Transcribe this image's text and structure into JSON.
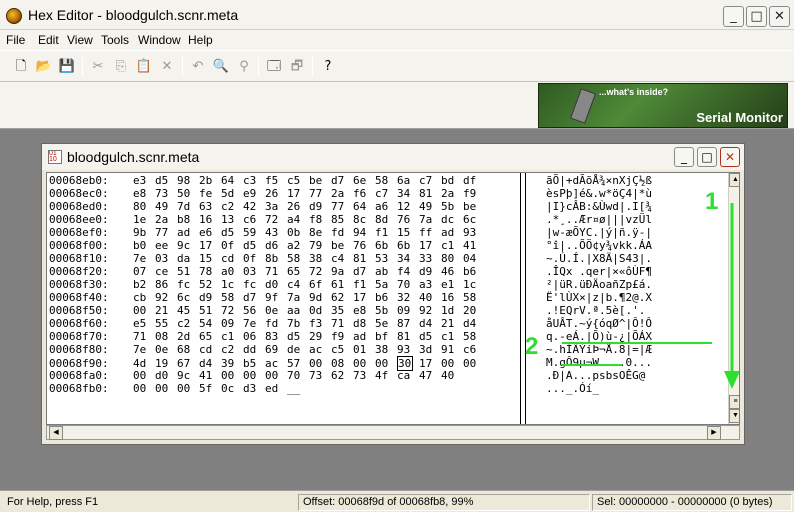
{
  "window": {
    "title": "Hex Editor - bloodgulch.scnr.meta",
    "min_icon": "minimize-icon",
    "max_icon": "maximize-icon",
    "close_icon": "close-icon"
  },
  "menu": [
    "File",
    "Edit",
    "View",
    "Tools",
    "Window",
    "Help"
  ],
  "toolbar_icons": [
    "new-icon",
    "open-icon",
    "save-icon",
    "cut-icon",
    "copy-icon",
    "paste-icon",
    "delete-icon",
    "undo-icon",
    "find-icon",
    "replace-icon",
    "export-icon",
    "import-icon",
    "help-icon"
  ],
  "banner": {
    "tagline": "...what's inside?",
    "name": "Serial Monitor"
  },
  "document": {
    "title": "bloodgulch.scnr.meta",
    "rows": [
      {
        "offset": "00068eb0:",
        "bytes": [
          "e3",
          "d5",
          "98",
          "2b",
          "64",
          "c3",
          "f5",
          "c5",
          "be",
          "d7",
          "6e",
          "58",
          "6a",
          "c7",
          "bd",
          "df"
        ],
        "ascii": "ãÕ|+dÃõÅ¾×nXjÇ½ß"
      },
      {
        "offset": "00068ec0:",
        "bytes": [
          "e8",
          "73",
          "50",
          "fe",
          "5d",
          "e9",
          "26",
          "17",
          "77",
          "2a",
          "f6",
          "c7",
          "34",
          "81",
          "2a",
          "f9"
        ],
        "ascii": "èsPþ]é&.w*öÇ4|*ù"
      },
      {
        "offset": "00068ed0:",
        "bytes": [
          "80",
          "49",
          "7d",
          "63",
          "c2",
          "42",
          "3a",
          "26",
          "d9",
          "77",
          "64",
          "a6",
          "12",
          "49",
          "5b",
          "be"
        ],
        "ascii": "|I}cÂB:&Ùwd|.I[¾"
      },
      {
        "offset": "00068ee0:",
        "bytes": [
          "1e",
          "2a",
          "b8",
          "16",
          "13",
          "c6",
          "72",
          "a4",
          "f8",
          "85",
          "8c",
          "8d",
          "76",
          "7a",
          "dc",
          "6c"
        ],
        "ascii": ".*¸..Ær¤ø|||vzÜl"
      },
      {
        "offset": "00068ef0:",
        "bytes": [
          "9b",
          "77",
          "ad",
          "e6",
          "d5",
          "59",
          "43",
          "0b",
          "8e",
          "fd",
          "94",
          "f1",
          "15",
          "ff",
          "ad",
          "93"
        ],
        "ascii": "|w-æÕYC.|ý|ñ.ÿ-|"
      },
      {
        "offset": "00068f00:",
        "bytes": [
          "b0",
          "ee",
          "9c",
          "17",
          "0f",
          "d5",
          "d6",
          "a2",
          "79",
          "be",
          "76",
          "6b",
          "6b",
          "17",
          "c1",
          "41"
        ],
        "ascii": "°î|..ÕÖ¢y¾vkk.ÁA"
      },
      {
        "offset": "00068f10:",
        "bytes": [
          "7e",
          "03",
          "da",
          "15",
          "cd",
          "0f",
          "8b",
          "58",
          "38",
          "c4",
          "81",
          "53",
          "34",
          "33",
          "80",
          "04"
        ],
        "ascii": "~.Ú.Í.|X8Ä|S43|."
      },
      {
        "offset": "00068f20:",
        "bytes": [
          "07",
          "ce",
          "51",
          "78",
          "a0",
          "03",
          "71",
          "65",
          "72",
          "9a",
          "d7",
          "ab",
          "f4",
          "d9",
          "46",
          "b6"
        ],
        "ascii": ".ÎQx .qer|×«ôÙF¶"
      },
      {
        "offset": "00068f30:",
        "bytes": [
          "b2",
          "86",
          "fc",
          "52",
          "1c",
          "fc",
          "d0",
          "c4",
          "6f",
          "61",
          "f1",
          "5a",
          "70",
          "a3",
          "e1",
          "1c"
        ],
        "ascii": "²|üR.üÐÄoañZp£á."
      },
      {
        "offset": "00068f40:",
        "bytes": [
          "cb",
          "92",
          "6c",
          "d9",
          "58",
          "d7",
          "9f",
          "7a",
          "9d",
          "62",
          "17",
          "b6",
          "32",
          "40",
          "16",
          "58"
        ],
        "ascii": "Ë'lÙX×|z|b.¶2@.X"
      },
      {
        "offset": "00068f50:",
        "bytes": [
          "00",
          "21",
          "45",
          "51",
          "72",
          "56",
          "0e",
          "aa",
          "0d",
          "35",
          "e8",
          "5b",
          "09",
          "92",
          "1d",
          "20"
        ],
        "ascii": ".!EQrV.ª.5è[.'. "
      },
      {
        "offset": "00068f60:",
        "bytes": [
          "e5",
          "55",
          "c2",
          "54",
          "09",
          "7e",
          "fd",
          "7b",
          "f3",
          "71",
          "d8",
          "5e",
          "87",
          "d4",
          "21",
          "d4"
        ],
        "ascii": "åUÂT.~ý{óqØ^|Ô!Ô"
      },
      {
        "offset": "00068f70:",
        "bytes": [
          "71",
          "08",
          "2d",
          "65",
          "c1",
          "06",
          "83",
          "d5",
          "29",
          "f9",
          "ad",
          "bf",
          "81",
          "d5",
          "c1",
          "58"
        ],
        "ascii": "q.-eÁ.|Õ)ù-¿|ÕÁX"
      },
      {
        "offset": "00068f80:",
        "bytes": [
          "7e",
          "0e",
          "68",
          "cd",
          "c2",
          "dd",
          "69",
          "de",
          "ac",
          "c5",
          "01",
          "38",
          "93",
          "3d",
          "91",
          "c6"
        ],
        "ascii": "~.hÍÂÝiÞ¬Å.8|=|Æ"
      },
      {
        "offset": "00068f90:",
        "bytes": [
          "4d",
          "19",
          "67",
          "d4",
          "39",
          "b5",
          "ac",
          "57",
          "00",
          "08",
          "00",
          "00",
          "30",
          "17",
          "00",
          "00"
        ],
        "ascii": "M.gÔ9µ¬W....0..."
      },
      {
        "offset": "00068fa0:",
        "bytes": [
          "00",
          "d0",
          "9c",
          "41",
          "00",
          "00",
          "00",
          "70",
          "73",
          "62",
          "73",
          "4f",
          "ca",
          "47",
          "40",
          ""
        ],
        "ascii": ".Ð|A...psbsOÊG@"
      },
      {
        "offset": "00068fb0:",
        "bytes": [
          "00",
          "00",
          "00",
          "5f",
          "0c",
          "d3",
          "ed",
          "__",
          "",
          "",
          "",
          "",
          "",
          "",
          "",
          ""
        ],
        "ascii": "..._.Óí_"
      }
    ],
    "caret_row": 14,
    "caret_col": 12
  },
  "annotations": [
    "1",
    "2"
  ],
  "status": {
    "help": "For Help, press F1",
    "offset": "Offset: 00068f9d of 00068fb8, 99%",
    "selection": "Sel: 00000000 - 00000000 (0 bytes)"
  }
}
